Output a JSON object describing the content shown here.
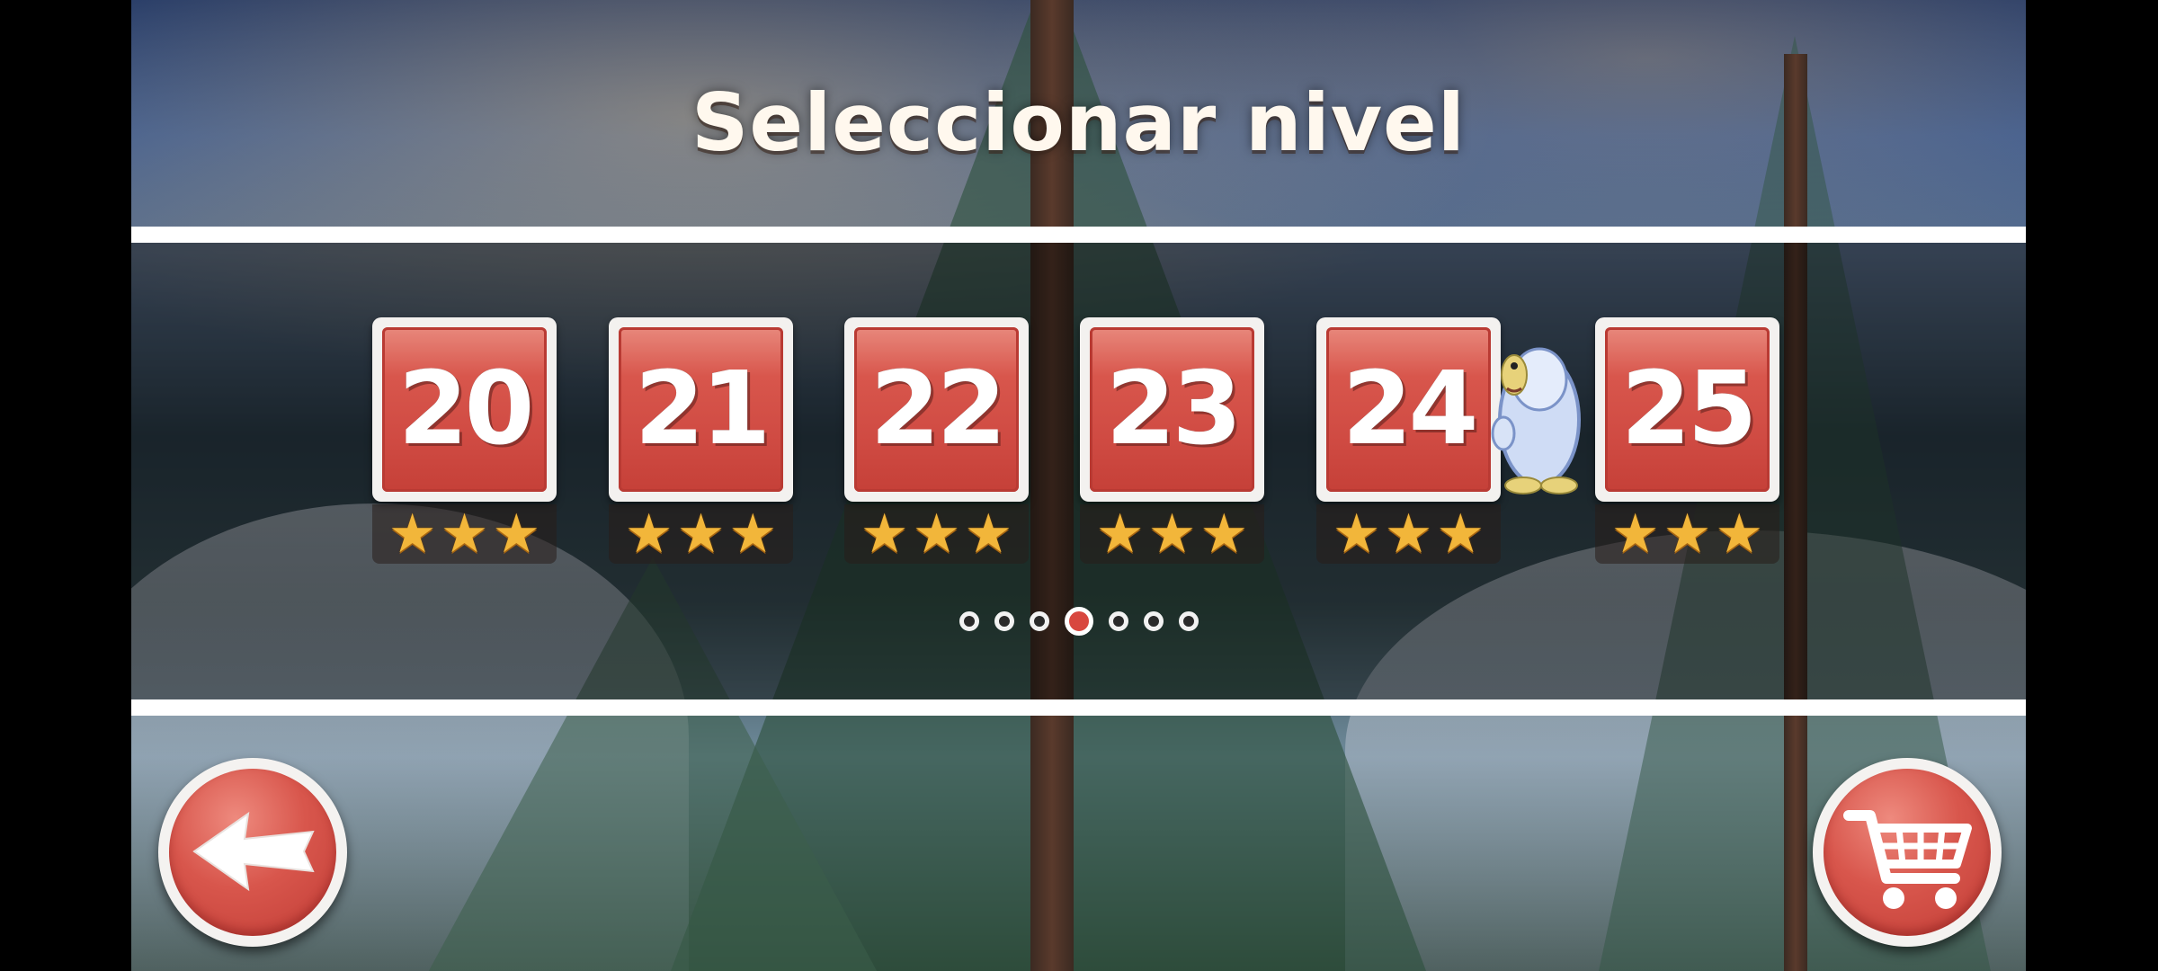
{
  "title": "Seleccionar nivel",
  "levels": [
    {
      "number": "20",
      "stars": 3
    },
    {
      "number": "21",
      "stars": 3
    },
    {
      "number": "22",
      "stars": 3
    },
    {
      "number": "23",
      "stars": 3
    },
    {
      "number": "24",
      "stars": 3
    },
    {
      "number": "25",
      "stars": 3
    }
  ],
  "pagination": {
    "total_pages": 7,
    "current_page": 4
  },
  "buttons": {
    "back": {
      "icon": "back-arrow-icon"
    },
    "shop": {
      "icon": "shopping-cart-icon"
    }
  },
  "colors": {
    "tile_red": "#d8564c",
    "star_gold": "#f2b63a",
    "active_dot": "#d8473f"
  }
}
